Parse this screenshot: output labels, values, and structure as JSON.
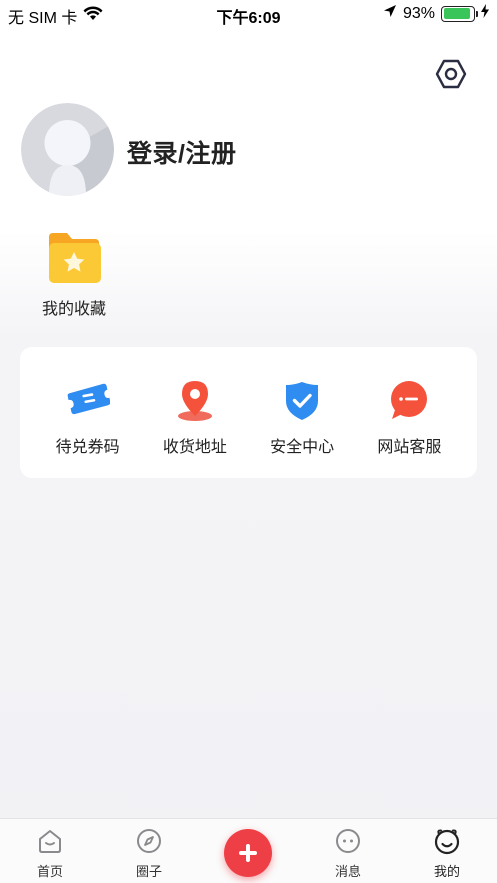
{
  "status_bar": {
    "carrier": "无 SIM 卡",
    "time": "下午6:09",
    "battery_percent": "93%",
    "battery_level": 0.93
  },
  "profile": {
    "login_label": "登录/注册"
  },
  "favorites": {
    "label": "我的收藏"
  },
  "services": [
    {
      "label": "待兑券码",
      "icon": "ticket-icon"
    },
    {
      "label": "收货地址",
      "icon": "location-pin-icon"
    },
    {
      "label": "安全中心",
      "icon": "shield-check-icon"
    },
    {
      "label": "网站客服",
      "icon": "chat-bubble-icon"
    }
  ],
  "tabbar": {
    "items": [
      {
        "label": "首页",
        "icon": "home-icon"
      },
      {
        "label": "圈子",
        "icon": "compass-icon"
      },
      {
        "label": "消息",
        "icon": "message-icon"
      },
      {
        "label": "我的",
        "icon": "smiley-face-icon"
      }
    ],
    "active": "我的",
    "accent": "#ef3f46"
  },
  "colors": {
    "accent_red": "#ef3f46",
    "icon_blue": "#2f8cf0",
    "folder_yellow": "#fbc02d",
    "battery_green": "#3ac55a"
  }
}
